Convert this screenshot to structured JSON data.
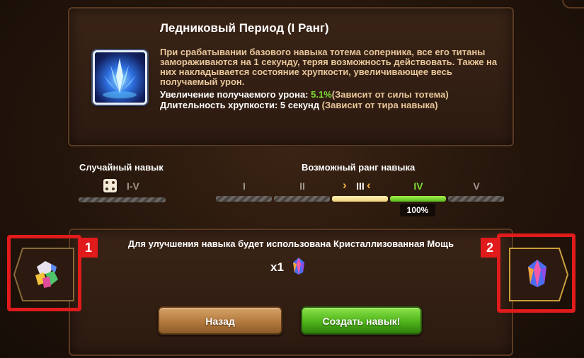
{
  "skill": {
    "title": "Ледниковый Период (I Ранг)",
    "description": "При срабатывании базового навыка тотема соперника, все его титаны замораживаются на 1 секунду, теряя возможность действовать. Также на них накладывается состояние хрупкости, увеличивающее весь получаемый урон.",
    "stat1_label": "Увеличение получаемого урона: ",
    "stat1_value": "5.1%",
    "stat1_note": "(Зависит от силы тотема)",
    "stat2_label": "Длительность хрупкости: 5 секунд ",
    "stat2_note": "(Зависит от тира навыка)",
    "icon": "ice-crystal-icon"
  },
  "random_skill": {
    "label": "Случайный навык",
    "icon": "dice-icon",
    "range": "I-V"
  },
  "possible_rank": {
    "label": "Возможный ранг навыка",
    "ranks": [
      "I",
      "II",
      "III",
      "IV",
      "V"
    ],
    "selected_rank": "III",
    "highlighted_rank": "IV",
    "percent": "100%"
  },
  "upgrade": {
    "text": "Для улучшения навыка будет использована Кристаллизованная Мощь",
    "cost_amount": "x1",
    "cost_icon": "crystallized-power-icon"
  },
  "buttons": {
    "back": "Назад",
    "create": "Создать навык!"
  },
  "side_tabs": {
    "prev_icon": "crystal-cluster-icon",
    "next_icon": "crystallized-power-icon"
  },
  "annotations": {
    "tag1": "1",
    "tag2": "2",
    "color": "#e11b1b"
  },
  "colors": {
    "accent_green": "#7fdc35",
    "text_tan": "#e9c79a",
    "panel_bg": "#2c1a10"
  }
}
